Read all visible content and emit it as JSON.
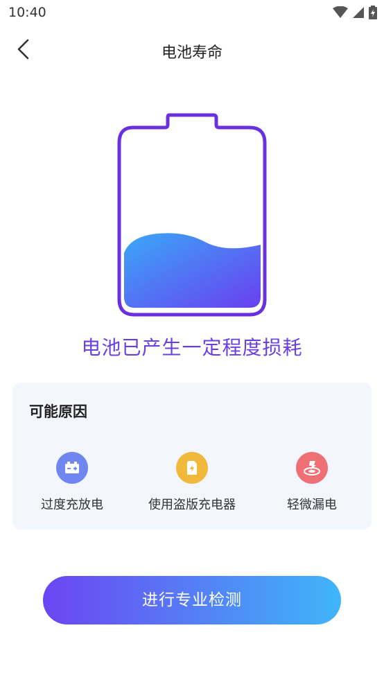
{
  "status_bar": {
    "time": "10:40"
  },
  "header": {
    "title": "电池寿命"
  },
  "battery": {
    "level": 0.36
  },
  "status_message": "电池已产生一定程度损耗",
  "reasons": {
    "title": "可能原因",
    "items": [
      {
        "label": "过度充放电",
        "icon": "battery-charge-icon",
        "color": "#6f86f0"
      },
      {
        "label": "使用盗版充电器",
        "icon": "charger-icon",
        "color": "#f0b93c"
      },
      {
        "label": "轻微漏电",
        "icon": "leak-icon",
        "color": "#ee6f74"
      }
    ]
  },
  "action_button": {
    "label": "进行专业检测"
  },
  "colors": {
    "accent_purple": "#6a3fe0",
    "card_bg": "#f4f6fd",
    "gradient_start": "#6b45f2",
    "gradient_end": "#3fb6f9"
  }
}
